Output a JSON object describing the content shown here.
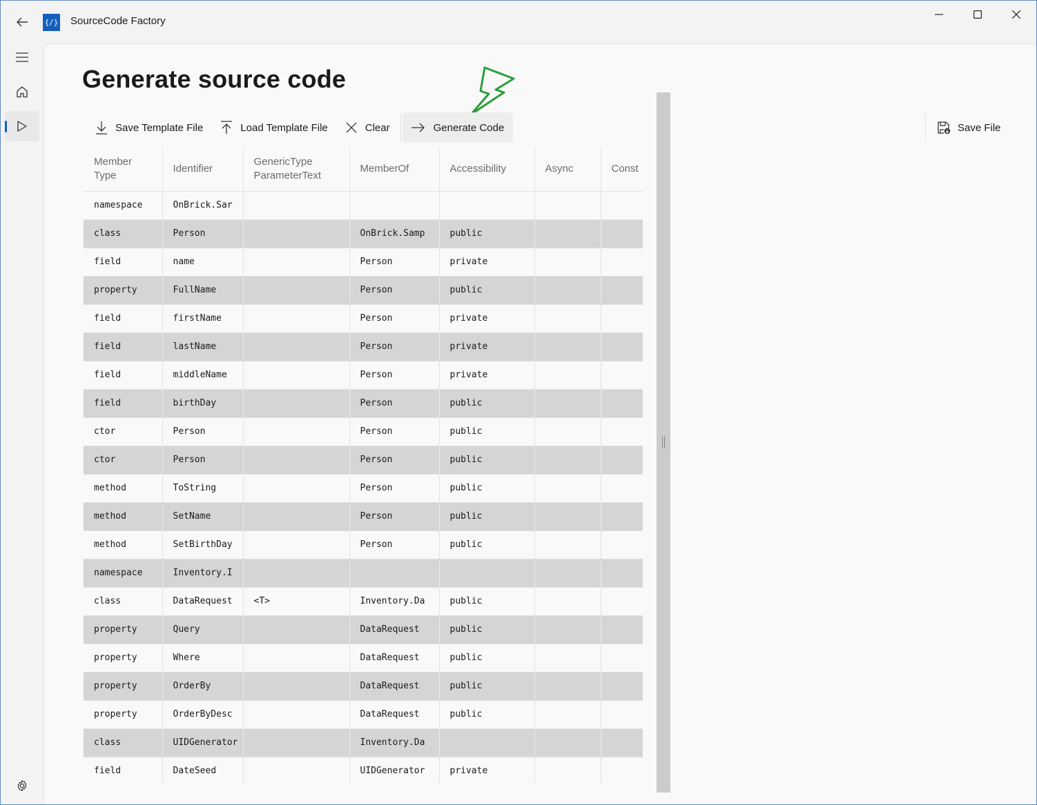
{
  "app": {
    "title": "SourceCode Factory",
    "icon_glyph": "{/}"
  },
  "page": {
    "title": "Generate source code"
  },
  "toolbar": {
    "save_template": "Save Template File",
    "load_template": "Load Template File",
    "clear": "Clear",
    "generate": "Generate Code"
  },
  "right_toolbar": {
    "save_file": "Save File"
  },
  "nav": {
    "items": [
      "menu-icon",
      "home-icon",
      "play-icon"
    ],
    "footer": "gear-icon"
  },
  "colors": {
    "accent": "#0a5fc4",
    "row_alt": "#d5d5d5",
    "lightning": "#2a9d3a"
  },
  "grid": {
    "headers": [
      "Member Type",
      "Identifier",
      "GenericType ParameterText",
      "MemberOf",
      "Accessibility",
      "Async",
      "Const"
    ],
    "rows": [
      [
        "namespace",
        "OnBrick.Sar",
        "",
        "",
        "",
        "",
        ""
      ],
      [
        "class",
        "Person",
        "",
        "OnBrick.Samp",
        "public",
        "",
        ""
      ],
      [
        "field",
        "name",
        "",
        "Person",
        "private",
        "",
        ""
      ],
      [
        "property",
        "FullName",
        "",
        "Person",
        "public",
        "",
        ""
      ],
      [
        "field",
        "firstName",
        "",
        "Person",
        "private",
        "",
        ""
      ],
      [
        "field",
        "lastName",
        "",
        "Person",
        "private",
        "",
        ""
      ],
      [
        "field",
        "middleName",
        "",
        "Person",
        "private",
        "",
        ""
      ],
      [
        "field",
        "birthDay",
        "",
        "Person",
        "public",
        "",
        ""
      ],
      [
        "ctor",
        "Person",
        "",
        "Person",
        "public",
        "",
        ""
      ],
      [
        "ctor",
        "Person",
        "",
        "Person",
        "public",
        "",
        ""
      ],
      [
        "method",
        "ToString",
        "",
        "Person",
        "public",
        "",
        ""
      ],
      [
        "method",
        "SetName",
        "",
        "Person",
        "public",
        "",
        ""
      ],
      [
        "method",
        "SetBirthDay",
        "",
        "Person",
        "public",
        "",
        ""
      ],
      [
        "namespace",
        "Inventory.I",
        "",
        "",
        "",
        "",
        ""
      ],
      [
        "class",
        "DataRequest",
        "<T>",
        "Inventory.Da",
        "public",
        "",
        ""
      ],
      [
        "property",
        "Query",
        "",
        "DataRequest",
        "public",
        "",
        ""
      ],
      [
        "property",
        "Where",
        "",
        "DataRequest",
        "public",
        "",
        ""
      ],
      [
        "property",
        "OrderBy",
        "",
        "DataRequest",
        "public",
        "",
        ""
      ],
      [
        "property",
        "OrderByDesc",
        "",
        "DataRequest",
        "public",
        "",
        ""
      ],
      [
        "class",
        "UIDGenerator",
        "",
        "Inventory.Da",
        "",
        "",
        ""
      ],
      [
        "field",
        "DateSeed",
        "",
        "UIDGenerator",
        "private",
        "",
        ""
      ]
    ]
  }
}
